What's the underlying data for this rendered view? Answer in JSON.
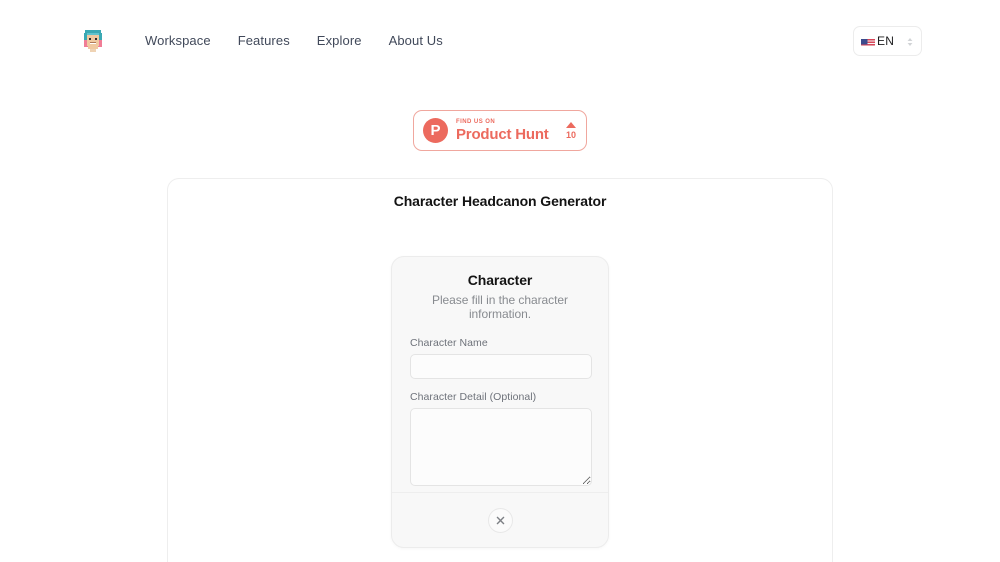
{
  "header": {
    "logo_icon": "avatar-logo-icon",
    "nav": [
      {
        "label": "Workspace"
      },
      {
        "label": "Features"
      },
      {
        "label": "Explore"
      },
      {
        "label": "About Us"
      }
    ],
    "language": {
      "flag_icon": "us-flag-icon",
      "code": "EN",
      "chevron_icon": "chevron-up-down-icon"
    }
  },
  "product_hunt": {
    "mark": "P",
    "kicker": "FIND US ON",
    "name": "Product Hunt",
    "upvote_icon": "triangle-up-icon",
    "count": "10",
    "accent_color": "#ec6a5e"
  },
  "panel": {
    "title": "Character Headcanon Generator"
  },
  "modal": {
    "title": "Character",
    "subtitle": "Please fill in the character information.",
    "fields": [
      {
        "label": "Character Name",
        "value": "",
        "placeholder": ""
      },
      {
        "label": "Character Detail (Optional)",
        "value": "",
        "placeholder": ""
      }
    ],
    "close_icon": "close-icon"
  },
  "colors": {
    "page_background": "#ffffff",
    "nav_text": "#41495a",
    "modal_background": "#f8f8f8",
    "border": "#ececec",
    "muted_text": "#888b90"
  }
}
